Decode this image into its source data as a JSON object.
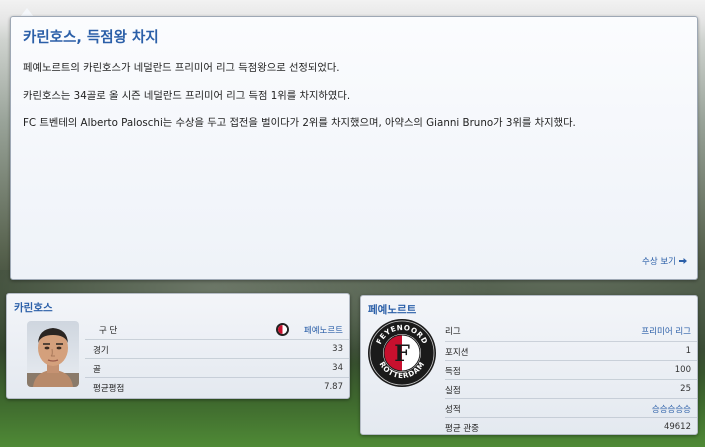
{
  "news": {
    "title": "카린호스, 득점왕 차지",
    "paragraphs": [
      "페예노르트의 카린호스가 네덜란드 프리미어 리그 득점왕으로 선정되었다.",
      "카린호스는 34골로 올 시즌 네덜란드 프리미어 리그 득점 1위를 차지하였다.",
      "FC 트벤테의 Alberto Paloschi는 수상을 두고 접전을 벌이다가 2위를 차지했으며, 아약스의 Gianni Bruno가 3위를 차지했다."
    ],
    "award_link": "수상 보기",
    "award_icon": "arrow-right-icon"
  },
  "player_card": {
    "title": "카린호스",
    "rows": [
      {
        "label": "구 단",
        "value": "페예노르트"
      },
      {
        "label": "경기",
        "value": "33"
      },
      {
        "label": "골",
        "value": "34"
      },
      {
        "label": "평균평점",
        "value": "7.87"
      }
    ]
  },
  "club_card": {
    "title": "페예노르트",
    "crest_top_text": "FEYENOORD",
    "crest_bottom_text": "ROTTERDAM",
    "crest_letter": "F",
    "rows": [
      {
        "label": "리그",
        "value": "프리미어 리그"
      },
      {
        "label": "포지션",
        "value": "1"
      },
      {
        "label": "득점",
        "value": "100"
      },
      {
        "label": "실점",
        "value": "25"
      },
      {
        "label": "성적",
        "value": "승승승승승"
      },
      {
        "label": "평균 관중",
        "value": "49612"
      }
    ]
  },
  "colors": {
    "accent": "#2b5fa8",
    "crest_red": "#c8102e",
    "crest_dark": "#1a1a1a"
  }
}
